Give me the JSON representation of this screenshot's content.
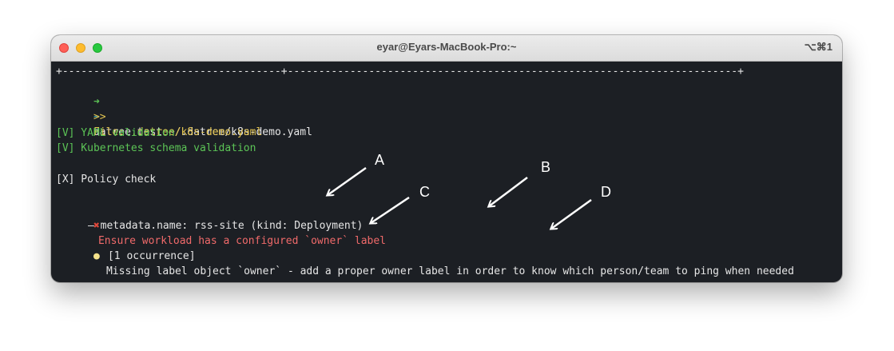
{
  "window": {
    "title": "eyar@Eyars-MacBook-Pro:~",
    "shortcut": "⌥⌘1"
  },
  "terminal": {
    "separator": "+-----------------------------------+------------------------------------------------------------------------+",
    "prompt_arrow": "➜",
    "prompt_dir": "~",
    "command": "datree test ~/.datree/k8s-demo.yaml",
    "file_marker": ">>",
    "file_line": "File: .datree/k8s-demo.yaml",
    "yaml_validation": "[V] YAML validation",
    "schema_validation": "[V] Kubernetes schema validation",
    "policy_check": "[X] Policy check",
    "rule_title": "Ensure workload has a configured `owner` label",
    "occurrence": "[1 occurrence]",
    "metadata": "— metadata.name: rss-site (kind: Deployment)",
    "suggestion": "Missing label object `owner` - add a proper owner label in order to know which person/team to ping when needed"
  },
  "annotations": {
    "a": "A",
    "b": "B",
    "c": "C",
    "d": "D"
  },
  "icons": {
    "error": "cross-mark-icon",
    "hint": "light-bulb-icon"
  }
}
